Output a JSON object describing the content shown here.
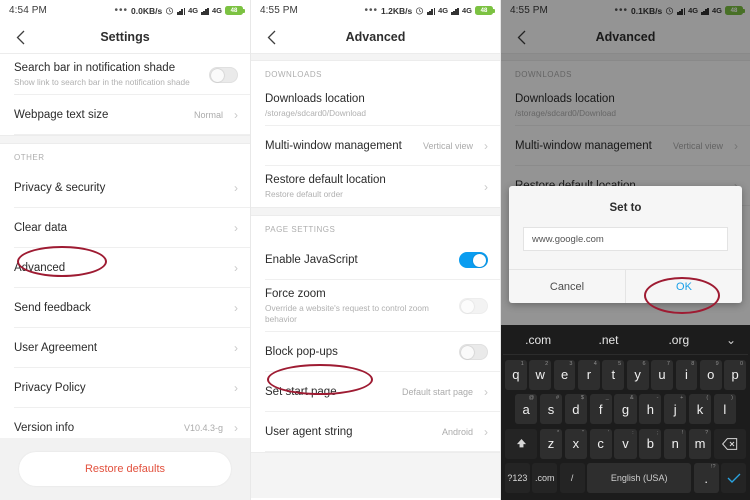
{
  "panels": [
    {
      "id": "settings",
      "status": {
        "time": "4:54 PM",
        "dots": "•••",
        "net_speed": "0.0KB/s",
        "alarm_icon": "alarm-icon",
        "sim1": "4G",
        "sim2": "4G",
        "battery": "48"
      },
      "nav": {
        "back_icon": "chevron-left-icon",
        "title": "Settings"
      },
      "rows": [
        {
          "title": "Search bar in notification shade",
          "sub": "Show link to search bar in the notification shade",
          "control": "toggle-off"
        },
        {
          "title": "Webpage text size",
          "value": "Normal",
          "control": "chevron"
        }
      ],
      "section_label": "OTHER",
      "rows2": [
        {
          "title": "Privacy & security",
          "control": "chevron"
        },
        {
          "title": "Clear data",
          "control": "chevron"
        },
        {
          "title": "Advanced",
          "control": "chevron",
          "highlight": true
        },
        {
          "title": "Send feedback",
          "control": "chevron"
        },
        {
          "title": "User Agreement",
          "control": "chevron"
        },
        {
          "title": "Privacy Policy",
          "control": "chevron"
        },
        {
          "title": "Version info",
          "value": "V10.4.3-g",
          "control": "chevron"
        }
      ],
      "footer_button": "Restore defaults"
    },
    {
      "id": "advanced",
      "status": {
        "time": "4:55 PM",
        "dots": "•••",
        "net_speed": "1.2KB/s",
        "alarm_icon": "alarm-icon",
        "sim1": "4G",
        "sim2": "4G",
        "battery": "48"
      },
      "nav": {
        "back_icon": "chevron-left-icon",
        "title": "Advanced"
      },
      "section_downloads": "DOWNLOADS",
      "rows": [
        {
          "title": "Downloads location",
          "sub": "/storage/sdcard0/Download",
          "control": "none"
        },
        {
          "title": "Multi-window management",
          "value": "Vertical view",
          "control": "chevron"
        },
        {
          "title": "Restore default location",
          "sub": "Restore default order",
          "control": "chevron"
        }
      ],
      "section_page": "PAGE SETTINGS",
      "rows2": [
        {
          "title": "Enable JavaScript",
          "control": "toggle-on"
        },
        {
          "title": "Force zoom",
          "sub": "Override a website's request to control zoom behavior",
          "control": "toggle-off-dim"
        },
        {
          "title": "Block pop-ups",
          "control": "toggle-off"
        },
        {
          "title": "Set start page",
          "value": "Default start page",
          "control": "chevron",
          "highlight": true
        },
        {
          "title": "User agent string",
          "value": "Android",
          "control": "chevron"
        }
      ]
    },
    {
      "id": "advanced-dialog",
      "status": {
        "time": "4:55 PM",
        "dots": "•••",
        "net_speed": "0.1KB/s",
        "alarm_icon": "alarm-icon",
        "sim1": "4G",
        "sim2": "4G",
        "battery": "48"
      },
      "nav": {
        "back_icon": "chevron-left-icon",
        "title": "Advanced"
      },
      "section_downloads": "DOWNLOADS",
      "rows": [
        {
          "title": "Downloads location",
          "sub": "/storage/sdcard0/Download",
          "control": "none"
        },
        {
          "title": "Multi-window management",
          "value": "Vertical view",
          "control": "chevron"
        },
        {
          "title": "Restore default location",
          "control": "chevron"
        }
      ],
      "dialog": {
        "title": "Set to",
        "input_value": "www.google.com",
        "input_placeholder": "",
        "cancel": "Cancel",
        "ok": "OK"
      },
      "keyboard": {
        "suggestions": [
          ".com",
          ".net",
          ".org"
        ],
        "collapse_icon": "chevron-down-icon",
        "row1": [
          {
            "k": "q",
            "h": "1"
          },
          {
            "k": "w",
            "h": "2"
          },
          {
            "k": "e",
            "h": "3"
          },
          {
            "k": "r",
            "h": "4"
          },
          {
            "k": "t",
            "h": "5"
          },
          {
            "k": "y",
            "h": "6"
          },
          {
            "k": "u",
            "h": "7"
          },
          {
            "k": "i",
            "h": "8"
          },
          {
            "k": "o",
            "h": "9"
          },
          {
            "k": "p",
            "h": "0"
          }
        ],
        "row2": [
          {
            "k": "a",
            "h": "@"
          },
          {
            "k": "s",
            "h": "#"
          },
          {
            "k": "d",
            "h": "$"
          },
          {
            "k": "f",
            "h": "_"
          },
          {
            "k": "g",
            "h": "&"
          },
          {
            "k": "h",
            "h": "-"
          },
          {
            "k": "j",
            "h": "+"
          },
          {
            "k": "k",
            "h": "("
          },
          {
            "k": "l",
            "h": ")"
          }
        ],
        "row3": [
          {
            "k": "z",
            "h": "*"
          },
          {
            "k": "x",
            "h": "\""
          },
          {
            "k": "c",
            "h": "'"
          },
          {
            "k": "v",
            "h": ":"
          },
          {
            "k": "b",
            "h": ";"
          },
          {
            "k": "n",
            "h": "!"
          },
          {
            "k": "m",
            "h": "?"
          }
        ],
        "shift_icon": "shift-icon",
        "backspace_icon": "backspace-icon",
        "symbols_key": "?123",
        "dotcom_key": ".com",
        "slash_key": "/",
        "space_key": "English (USA)",
        "period_key": ".",
        "period_hint": "!?",
        "enter_icon": "check-icon"
      }
    }
  ],
  "annotation_color": "#9e1b32"
}
